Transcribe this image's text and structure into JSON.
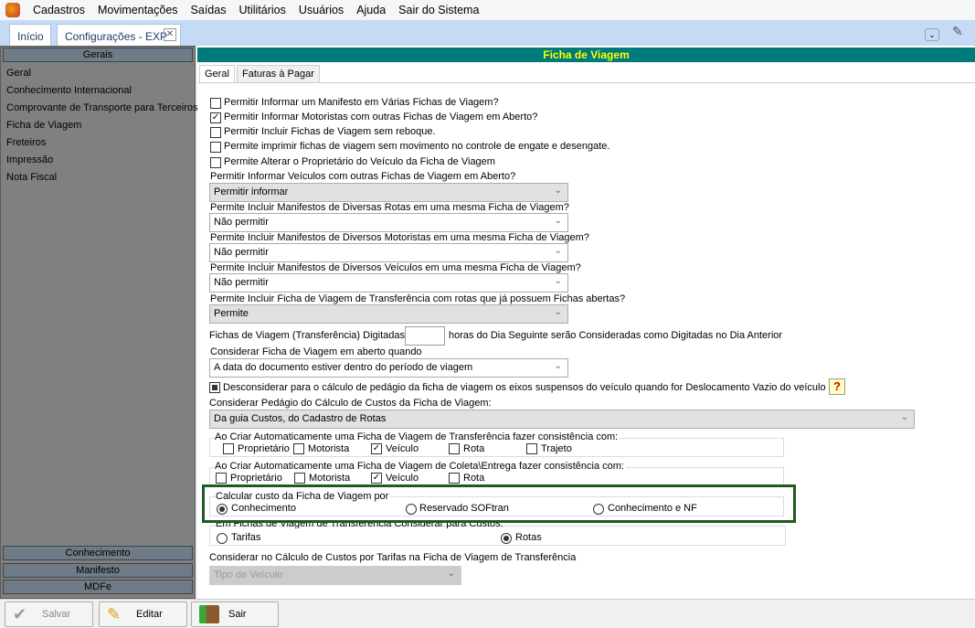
{
  "menu": [
    "Cadastros",
    "Movimentações",
    "Saídas",
    "Utilitários",
    "Usuários",
    "Ajuda",
    "Sair do Sistema"
  ],
  "doc_tabs": [
    "Início",
    "Configurações - EXP"
  ],
  "left": {
    "header": "Gerais",
    "items": [
      "Geral",
      "Conhecimento Internacional",
      "Comprovante de Transporte para Terceiros",
      "Ficha de Viagem",
      "Freteiros",
      "Impressão",
      "Nota Fiscal"
    ],
    "sections": [
      "Conhecimento",
      "Manifesto",
      "MDFe"
    ]
  },
  "title": "Ficha de Viagem",
  "tabs": [
    "Geral",
    "Faturas à Pagar"
  ],
  "checks": [
    {
      "label": "Permitir Informar um Manifesto em Várias Fichas de Viagem?",
      "checked": false
    },
    {
      "label": "Permitir Informar Motoristas com outras Fichas de Viagem em Aberto?",
      "checked": true
    },
    {
      "label": "Permitir Incluir Fichas de Viagem sem reboque.",
      "checked": false
    },
    {
      "label": "Permite imprimir fichas de viagem sem movimento no controle de engate e desengate.",
      "checked": false
    },
    {
      "label": "Permite Alterar o Proprietário do Veículo da Ficha de Viagem",
      "checked": false
    }
  ],
  "selects": [
    {
      "label": "Permitir Informar Veículos com outras Fichas de Viagem em Aberto?",
      "value": "Permitir informar"
    },
    {
      "label": "Permite Incluir Manifestos de Diversas Rotas em uma mesma Ficha de Viagem?",
      "value": "Não permitir"
    },
    {
      "label": "Permite Incluir Manifestos de Diversos Motoristas em uma mesma Ficha de Viagem?",
      "value": "Não permitir"
    },
    {
      "label": "Permite Incluir Manifestos de Diversos Veículos em uma mesma Ficha de Viagem?",
      "value": "Não permitir"
    },
    {
      "label": "Permite Incluir Ficha de Viagem de Transferência com  rotas que já  possuem Fichas abertas?",
      "value": "Permite"
    }
  ],
  "hours": {
    "prefix": "Fichas de Viagem (Transferência) Digitadas",
    "value": "",
    "suffix": "horas do Dia Seguinte serão Consideradas como Digitadas no Dia Anterior"
  },
  "open_when": {
    "label": "Considerar Ficha de Viagem em aberto quando",
    "value": "A data do documento estiver dentro do período de viagem"
  },
  "eixos": {
    "label": "Desconsiderar para o cálculo de pedágio da ficha de viagem os eixos suspensos do veículo quando for Deslocamento Vazio do veículo",
    "help": "?"
  },
  "pedagio": {
    "label": "Considerar Pedágio do Cálculo de Custos da Ficha de Viagem:",
    "value": "Da guia Custos, do Cadastro de Rotas"
  },
  "grp_transf": {
    "label": "Ao Criar Automaticamente uma Ficha de Viagem de Transferência fazer consistência com:",
    "items": [
      {
        "label": "Proprietário",
        "checked": false
      },
      {
        "label": "Motorista",
        "checked": false
      },
      {
        "label": "Veículo",
        "checked": true
      },
      {
        "label": "Rota",
        "checked": false
      },
      {
        "label": "Trajeto",
        "checked": false
      }
    ]
  },
  "grp_coleta": {
    "label": "Ao Criar Automaticamente uma Ficha de Viagem de Coleta\\Entrega fazer consistência com:",
    "items": [
      {
        "label": "Proprietário",
        "checked": false
      },
      {
        "label": "Motorista",
        "checked": false
      },
      {
        "label": "Veículo",
        "checked": true
      },
      {
        "label": "Rota",
        "checked": false
      }
    ]
  },
  "grp_custo": {
    "label": "Calcular custo da Ficha de Viagem por",
    "options": [
      "Conhecimento",
      "Reservado SOFtran",
      "Conhecimento e NF"
    ],
    "selected": 0
  },
  "grp_transf_custos": {
    "label": "Em Fichas de Viagem de Transferência Considerar para Custos:",
    "options": [
      "Tarifas",
      "Rotas"
    ],
    "selected": 1
  },
  "tarifas": {
    "label": "Considerar no Cálculo de Custos por Tarifas na Ficha de Viagem de Transferência",
    "value": "Tipo de Veículo"
  },
  "toolbar": {
    "save": "Salvar",
    "edit": "Editar",
    "exit": "Sair"
  },
  "colors": {
    "teal": "#007b7b",
    "highlight": "#1f5a1f"
  }
}
